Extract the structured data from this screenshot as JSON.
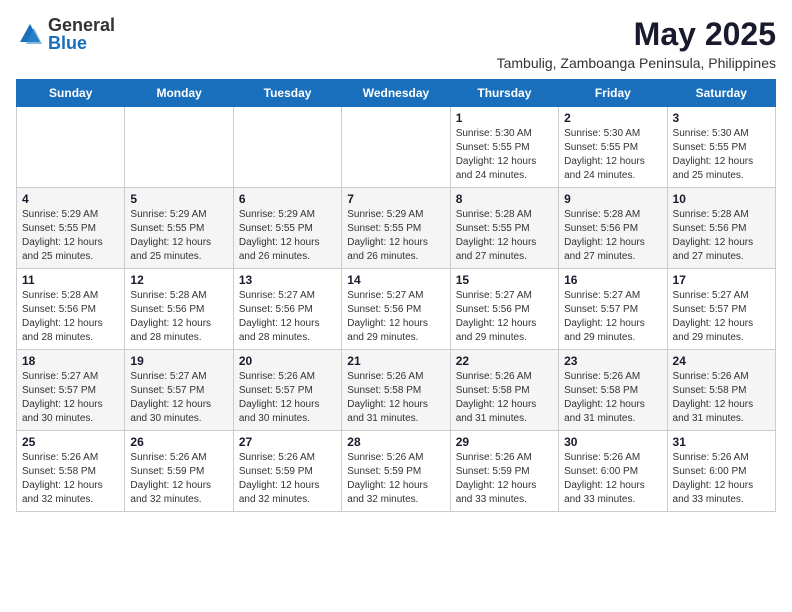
{
  "logo": {
    "general": "General",
    "blue": "Blue"
  },
  "header": {
    "title": "May 2025",
    "subtitle": "Tambulig, Zamboanga Peninsula, Philippines"
  },
  "weekdays": [
    "Sunday",
    "Monday",
    "Tuesday",
    "Wednesday",
    "Thursday",
    "Friday",
    "Saturday"
  ],
  "weeks": [
    [
      {
        "day": "",
        "info": ""
      },
      {
        "day": "",
        "info": ""
      },
      {
        "day": "",
        "info": ""
      },
      {
        "day": "",
        "info": ""
      },
      {
        "day": "1",
        "info": "Sunrise: 5:30 AM\nSunset: 5:55 PM\nDaylight: 12 hours and 24 minutes."
      },
      {
        "day": "2",
        "info": "Sunrise: 5:30 AM\nSunset: 5:55 PM\nDaylight: 12 hours and 24 minutes."
      },
      {
        "day": "3",
        "info": "Sunrise: 5:30 AM\nSunset: 5:55 PM\nDaylight: 12 hours and 25 minutes."
      }
    ],
    [
      {
        "day": "4",
        "info": "Sunrise: 5:29 AM\nSunset: 5:55 PM\nDaylight: 12 hours and 25 minutes."
      },
      {
        "day": "5",
        "info": "Sunrise: 5:29 AM\nSunset: 5:55 PM\nDaylight: 12 hours and 25 minutes."
      },
      {
        "day": "6",
        "info": "Sunrise: 5:29 AM\nSunset: 5:55 PM\nDaylight: 12 hours and 26 minutes."
      },
      {
        "day": "7",
        "info": "Sunrise: 5:29 AM\nSunset: 5:55 PM\nDaylight: 12 hours and 26 minutes."
      },
      {
        "day": "8",
        "info": "Sunrise: 5:28 AM\nSunset: 5:55 PM\nDaylight: 12 hours and 27 minutes."
      },
      {
        "day": "9",
        "info": "Sunrise: 5:28 AM\nSunset: 5:56 PM\nDaylight: 12 hours and 27 minutes."
      },
      {
        "day": "10",
        "info": "Sunrise: 5:28 AM\nSunset: 5:56 PM\nDaylight: 12 hours and 27 minutes."
      }
    ],
    [
      {
        "day": "11",
        "info": "Sunrise: 5:28 AM\nSunset: 5:56 PM\nDaylight: 12 hours and 28 minutes."
      },
      {
        "day": "12",
        "info": "Sunrise: 5:28 AM\nSunset: 5:56 PM\nDaylight: 12 hours and 28 minutes."
      },
      {
        "day": "13",
        "info": "Sunrise: 5:27 AM\nSunset: 5:56 PM\nDaylight: 12 hours and 28 minutes."
      },
      {
        "day": "14",
        "info": "Sunrise: 5:27 AM\nSunset: 5:56 PM\nDaylight: 12 hours and 29 minutes."
      },
      {
        "day": "15",
        "info": "Sunrise: 5:27 AM\nSunset: 5:56 PM\nDaylight: 12 hours and 29 minutes."
      },
      {
        "day": "16",
        "info": "Sunrise: 5:27 AM\nSunset: 5:57 PM\nDaylight: 12 hours and 29 minutes."
      },
      {
        "day": "17",
        "info": "Sunrise: 5:27 AM\nSunset: 5:57 PM\nDaylight: 12 hours and 29 minutes."
      }
    ],
    [
      {
        "day": "18",
        "info": "Sunrise: 5:27 AM\nSunset: 5:57 PM\nDaylight: 12 hours and 30 minutes."
      },
      {
        "day": "19",
        "info": "Sunrise: 5:27 AM\nSunset: 5:57 PM\nDaylight: 12 hours and 30 minutes."
      },
      {
        "day": "20",
        "info": "Sunrise: 5:26 AM\nSunset: 5:57 PM\nDaylight: 12 hours and 30 minutes."
      },
      {
        "day": "21",
        "info": "Sunrise: 5:26 AM\nSunset: 5:58 PM\nDaylight: 12 hours and 31 minutes."
      },
      {
        "day": "22",
        "info": "Sunrise: 5:26 AM\nSunset: 5:58 PM\nDaylight: 12 hours and 31 minutes."
      },
      {
        "day": "23",
        "info": "Sunrise: 5:26 AM\nSunset: 5:58 PM\nDaylight: 12 hours and 31 minutes."
      },
      {
        "day": "24",
        "info": "Sunrise: 5:26 AM\nSunset: 5:58 PM\nDaylight: 12 hours and 31 minutes."
      }
    ],
    [
      {
        "day": "25",
        "info": "Sunrise: 5:26 AM\nSunset: 5:58 PM\nDaylight: 12 hours and 32 minutes."
      },
      {
        "day": "26",
        "info": "Sunrise: 5:26 AM\nSunset: 5:59 PM\nDaylight: 12 hours and 32 minutes."
      },
      {
        "day": "27",
        "info": "Sunrise: 5:26 AM\nSunset: 5:59 PM\nDaylight: 12 hours and 32 minutes."
      },
      {
        "day": "28",
        "info": "Sunrise: 5:26 AM\nSunset: 5:59 PM\nDaylight: 12 hours and 32 minutes."
      },
      {
        "day": "29",
        "info": "Sunrise: 5:26 AM\nSunset: 5:59 PM\nDaylight: 12 hours and 33 minutes."
      },
      {
        "day": "30",
        "info": "Sunrise: 5:26 AM\nSunset: 6:00 PM\nDaylight: 12 hours and 33 minutes."
      },
      {
        "day": "31",
        "info": "Sunrise: 5:26 AM\nSunset: 6:00 PM\nDaylight: 12 hours and 33 minutes."
      }
    ]
  ]
}
